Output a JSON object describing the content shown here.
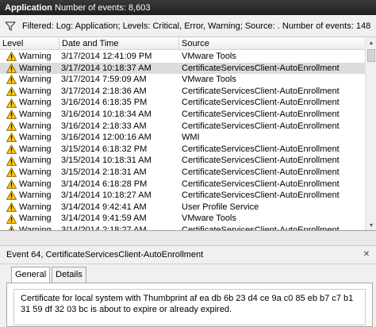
{
  "header": {
    "title": "Application",
    "count": "Number of events: 8,603"
  },
  "filter": {
    "text": "Filtered: Log: Application; Levels: Critical, Error, Warning; Source: . Number of events: 148"
  },
  "columns": [
    "Level",
    "Date and Time",
    "Source"
  ],
  "rows": [
    {
      "level": "Warning",
      "datetime": "3/17/2014 12:41:09 PM",
      "source": "VMware Tools",
      "selected": false
    },
    {
      "level": "Warning",
      "datetime": "3/17/2014 10:18:37 AM",
      "source": "CertificateServicesClient-AutoEnrollment",
      "selected": true
    },
    {
      "level": "Warning",
      "datetime": "3/17/2014 7:59:09 AM",
      "source": "VMware Tools",
      "selected": false
    },
    {
      "level": "Warning",
      "datetime": "3/17/2014 2:18:36 AM",
      "source": "CertificateServicesClient-AutoEnrollment",
      "selected": false
    },
    {
      "level": "Warning",
      "datetime": "3/16/2014 6:18:35 PM",
      "source": "CertificateServicesClient-AutoEnrollment",
      "selected": false
    },
    {
      "level": "Warning",
      "datetime": "3/16/2014 10:18:34 AM",
      "source": "CertificateServicesClient-AutoEnrollment",
      "selected": false
    },
    {
      "level": "Warning",
      "datetime": "3/16/2014 2:18:33 AM",
      "source": "CertificateServicesClient-AutoEnrollment",
      "selected": false
    },
    {
      "level": "Warning",
      "datetime": "3/16/2014 12:00:16 AM",
      "source": "WMI",
      "selected": false
    },
    {
      "level": "Warning",
      "datetime": "3/15/2014 6:18:32 PM",
      "source": "CertificateServicesClient-AutoEnrollment",
      "selected": false
    },
    {
      "level": "Warning",
      "datetime": "3/15/2014 10:18:31 AM",
      "source": "CertificateServicesClient-AutoEnrollment",
      "selected": false
    },
    {
      "level": "Warning",
      "datetime": "3/15/2014 2:18:31 AM",
      "source": "CertificateServicesClient-AutoEnrollment",
      "selected": false
    },
    {
      "level": "Warning",
      "datetime": "3/14/2014 6:18:28 PM",
      "source": "CertificateServicesClient-AutoEnrollment",
      "selected": false
    },
    {
      "level": "Warning",
      "datetime": "3/14/2014 10:18:27 AM",
      "source": "CertificateServicesClient-AutoEnrollment",
      "selected": false
    },
    {
      "level": "Warning",
      "datetime": "3/14/2014 9:42:41 AM",
      "source": "User Profile Service",
      "selected": false
    },
    {
      "level": "Warning",
      "datetime": "3/14/2014 9:41:59 AM",
      "source": "VMware Tools",
      "selected": false
    },
    {
      "level": "Warning",
      "datetime": "3/14/2014 2:18:27 AM",
      "source": "CertificateServicesClient-AutoEnrollment",
      "selected": false
    }
  ],
  "detail": {
    "title": "Event 64, CertificateServicesClient-AutoEnrollment",
    "tabs": [
      "General",
      "Details"
    ],
    "message": "Certificate for local system with Thumbprint af ea db 6b 23 d4 ce 9a c0 85 eb b7 c7 b1 31 59 df 32 03 bc is about to expire or already expired."
  },
  "icons": {
    "filter": "funnel-icon",
    "level": "warning-icon",
    "close": "close-icon"
  }
}
